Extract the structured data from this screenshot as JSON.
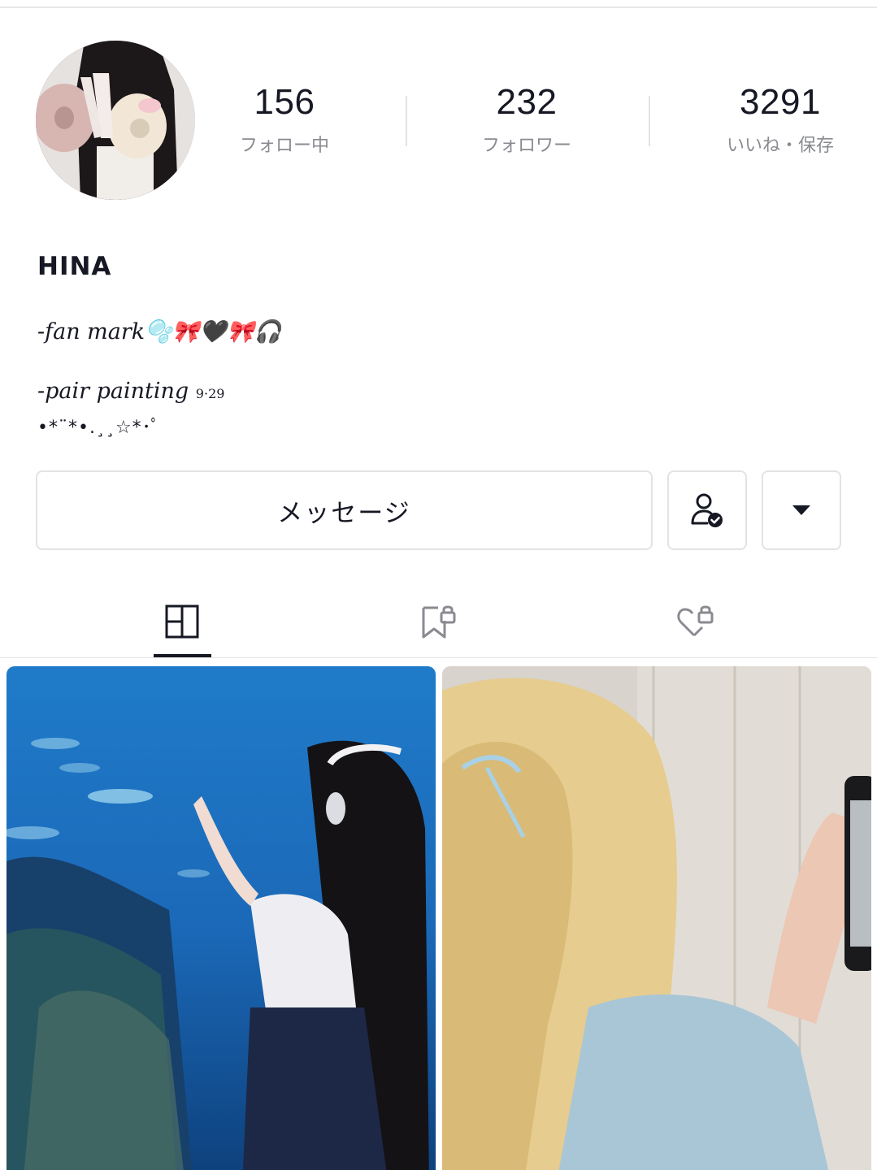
{
  "profile": {
    "username": "HINA",
    "bio_line1": "-fan mark🫧🎀🖤🎀🎧",
    "bio_line2_text": "-pair painting",
    "bio_line2_date": "9·29",
    "bio_line3": "•*¨*•.¸¸☆*･ﾟ"
  },
  "stats": {
    "following_count": "156",
    "following_label": "フォロー中",
    "followers_count": "232",
    "followers_label": "フォロワー",
    "likes_count": "3291",
    "likes_label": "いいね・保存"
  },
  "actions": {
    "message_label": "メッセージ"
  },
  "icons": {
    "friend": "person-check-icon",
    "more": "caret-down-icon",
    "tab_videos": "grid-icon",
    "tab_favorites": "bookmark-lock-icon",
    "tab_liked": "heart-lock-icon"
  },
  "colors": {
    "text_primary": "#161823",
    "text_secondary": "#8a8b91",
    "border": "#e3e3e6"
  }
}
